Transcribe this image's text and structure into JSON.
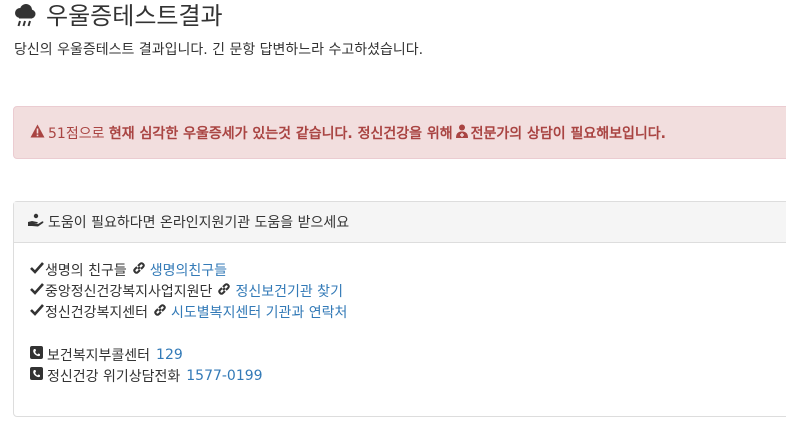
{
  "header": {
    "title": "우울증테스트결과",
    "title_icon": "rain-cloud-icon",
    "subtitle": "당신의 우울증테스트 결과입니다. 긴 문항 답변하느라 수고하셨습니다."
  },
  "alert": {
    "score_text": "51점으로",
    "message_strong_1": "현재 심각한 우울증세가 있는것 같습니다. 정신건강을 위해",
    "message_strong_2": "전문가의 상담이 필요해보입니다.",
    "colors": {
      "background": "#f2dede",
      "border": "#ebccd1",
      "text": "#a94442"
    }
  },
  "help_panel": {
    "heading": "도움이 필요하다면 온라인지원기관 도움을 받으세요",
    "links": [
      {
        "label": "생명의 친구들",
        "link_text": "생명의친구들"
      },
      {
        "label": "중앙정신건강복지사업지원단",
        "link_text": "정신보건기관 찾기"
      },
      {
        "label": "정신건강복지센터",
        "link_text": "시도별복지센터 기관과 연락처"
      }
    ],
    "phones": [
      {
        "label": "보건복지부콜센터",
        "number": "129"
      },
      {
        "label": "정신건강 위기상담전화",
        "number": "1577-0199"
      }
    ],
    "colors": {
      "link": "#337ab7",
      "heading_bg": "#f5f5f5"
    }
  }
}
